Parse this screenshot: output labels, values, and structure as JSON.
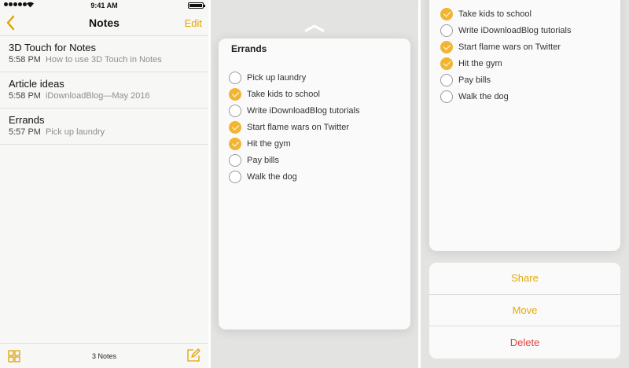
{
  "status_bar": {
    "time": "9:41 AM"
  },
  "notes_list": {
    "title": "Notes",
    "edit_label": "Edit",
    "notes": [
      {
        "title": "3D Touch for Notes",
        "time": "5:58 PM",
        "preview": "How to use 3D Touch in Notes"
      },
      {
        "title": "Article ideas",
        "time": "5:58 PM",
        "preview": "iDownloadBlog—May 2016"
      },
      {
        "title": "Errands",
        "time": "5:57 PM",
        "preview": "Pick up laundry"
      }
    ],
    "note_count": "3 Notes"
  },
  "peek": {
    "title": "Errands",
    "items": [
      {
        "label": "Pick up laundry",
        "checked": false
      },
      {
        "label": "Take kids to school",
        "checked": true
      },
      {
        "label": "Write iDownloadBlog tutorials",
        "checked": false
      },
      {
        "label": "Start flame wars on Twitter",
        "checked": true
      },
      {
        "label": "Hit the gym",
        "checked": true
      },
      {
        "label": "Pay bills",
        "checked": false
      },
      {
        "label": "Walk the dog",
        "checked": false
      }
    ]
  },
  "pop": {
    "items": [
      {
        "label": "Take kids to school",
        "checked": true
      },
      {
        "label": "Write iDownloadBlog tutorials",
        "checked": false
      },
      {
        "label": "Start flame wars on Twitter",
        "checked": true
      },
      {
        "label": "Hit the gym",
        "checked": true
      },
      {
        "label": "Pay bills",
        "checked": false
      },
      {
        "label": "Walk the dog",
        "checked": false
      }
    ],
    "actions": [
      {
        "label": "Share",
        "style": "default"
      },
      {
        "label": "Move",
        "style": "default"
      },
      {
        "label": "Delete",
        "style": "destructive"
      }
    ]
  },
  "colors": {
    "accent": "#e1a400",
    "check_fill": "#f2b531",
    "destructive": "#e0443c"
  },
  "icons": {
    "back": "chevron-left-icon",
    "grid": "grid-icon",
    "compose": "compose-icon",
    "peek_handle": "chevron-up-icon"
  }
}
